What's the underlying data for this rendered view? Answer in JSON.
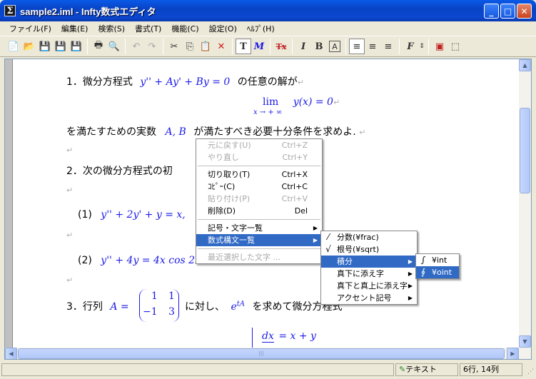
{
  "window": {
    "title": "sample2.iml - Infty数式エディタ"
  },
  "menu": [
    "ファイル(F)",
    "編集(E)",
    "検索(S)",
    "書式(T)",
    "機能(C)",
    "設定(O)",
    "ﾍﾙﾌﾟ(H)"
  ],
  "doc": {
    "p1_num": "1．微分方程式",
    "p1_eq": "y'' + Ay' + By = 0",
    "p1_tail": "の任意の解が",
    "lim_word": "lim",
    "lim_sub": "x → + ∞",
    "lim_eq": "y(x) = 0",
    "p1b_head": "を満たすための実数",
    "p1b_vars": "A, B",
    "p1b_tail": "が満たすべき必要十分条件を求めよ.",
    "p2_text": "2．次の微分方程式の初",
    "p2_1_label": "(1)",
    "p2_1_eq": "y'' + 2y' + y = x,",
    "p2_2_label": "(2)",
    "p2_2_eq": "y'' + 4y = 4x cos 2x",
    "p3_num": "3．行列",
    "p3_A": "A =",
    "p3_m11": "1",
    "p3_m12": "1",
    "p3_m21": "−1",
    "p3_m22": "3",
    "p3_mid": "に対し、",
    "p3_e": "e",
    "p3_exp": "tA",
    "p3_tail": "を求めて微分方程式",
    "p3_frac_num": "dx",
    "p3_rhs": "= x + y"
  },
  "context_menu": {
    "items": [
      {
        "label": "元に戻す(U)",
        "accel": "Ctrl+Z"
      },
      {
        "label": "やり直し",
        "accel": "Ctrl+Y"
      },
      {
        "label": "切り取り(T)",
        "accel": "Ctrl+X"
      },
      {
        "label": "ｺﾋﾟｰ(C)",
        "accel": "Ctrl+C"
      },
      {
        "label": "貼り付け(P)",
        "accel": "Ctrl+V"
      },
      {
        "label": "削除(D)",
        "accel": "Del"
      },
      {
        "label": "記号・文字一覧"
      },
      {
        "label": "数式構文一覧"
      },
      {
        "label": "最近選択した文字 ..."
      }
    ]
  },
  "submenu_syntax": {
    "items": [
      {
        "label": "分数(¥frac)",
        "icon": "fraction-icon"
      },
      {
        "label": "根号(¥sqrt)",
        "icon": "sqrt-icon"
      },
      {
        "label": "積分"
      },
      {
        "label": "真下に添え字"
      },
      {
        "label": "真下と真上に添え字"
      },
      {
        "label": "アクセント記号"
      }
    ]
  },
  "submenu_integral": {
    "items": [
      {
        "label": "¥int",
        "icon_char": "∫"
      },
      {
        "label": "¥oint",
        "icon_char": "∮"
      }
    ]
  },
  "status": {
    "mode": "テキスト",
    "position": "6行, 14列"
  },
  "toolbar": {
    "T": "T",
    "M": "M",
    "Tx": "Tx",
    "I": "I",
    "B": "B",
    "A": "A",
    "F": "F"
  }
}
